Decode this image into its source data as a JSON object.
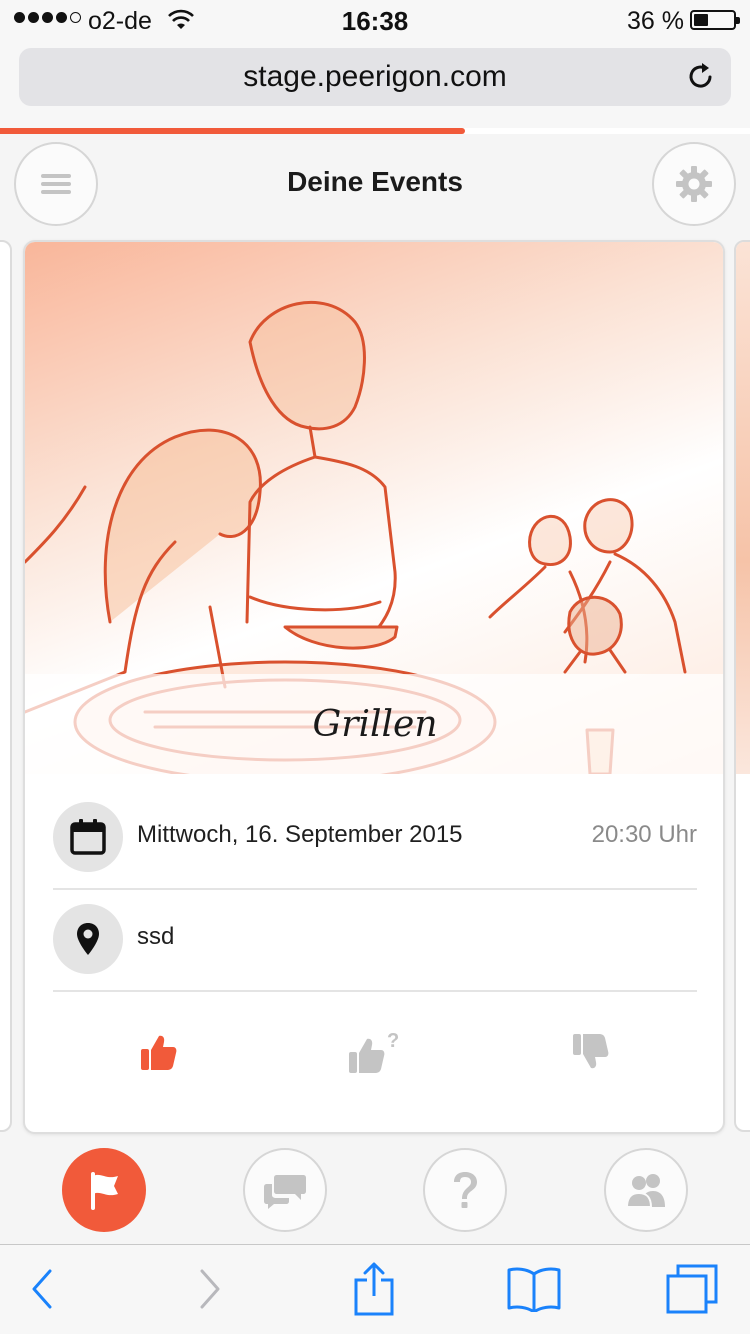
{
  "status_bar": {
    "carrier": "o2-de",
    "time": "16:38",
    "battery_percent": "36 %",
    "battery_level": 0.36,
    "signal_strength": 4,
    "signal_max": 5
  },
  "browser": {
    "url": "stage.peerigon.com",
    "load_progress": 0.62,
    "accent_color": "#f15a3a"
  },
  "header": {
    "title": "Deine Events",
    "menu_icon": "hamburger-icon",
    "settings_icon": "gear-icon"
  },
  "event": {
    "title": "Grillen",
    "date": "Mittwoch, 16. September 2015",
    "time": "20:30 Uhr",
    "location": "ssd",
    "date_icon": "calendar-icon",
    "location_icon": "map-pin-icon",
    "votes": {
      "yes_icon": "thumbs-up-icon",
      "maybe_icon": "thumbs-up-question-icon",
      "no_icon": "thumbs-down-icon",
      "selected": "yes"
    }
  },
  "app_nav": {
    "items": [
      {
        "icon": "flag-icon",
        "active": true
      },
      {
        "icon": "chat-bubbles-icon",
        "active": false
      },
      {
        "icon": "question-icon",
        "active": false
      },
      {
        "icon": "people-icon",
        "active": false
      }
    ]
  },
  "safari_toolbar": {
    "items": [
      "back-icon",
      "forward-icon",
      "share-icon",
      "bookmarks-icon",
      "tabs-icon"
    ],
    "tint_color": "#1a82fb"
  }
}
